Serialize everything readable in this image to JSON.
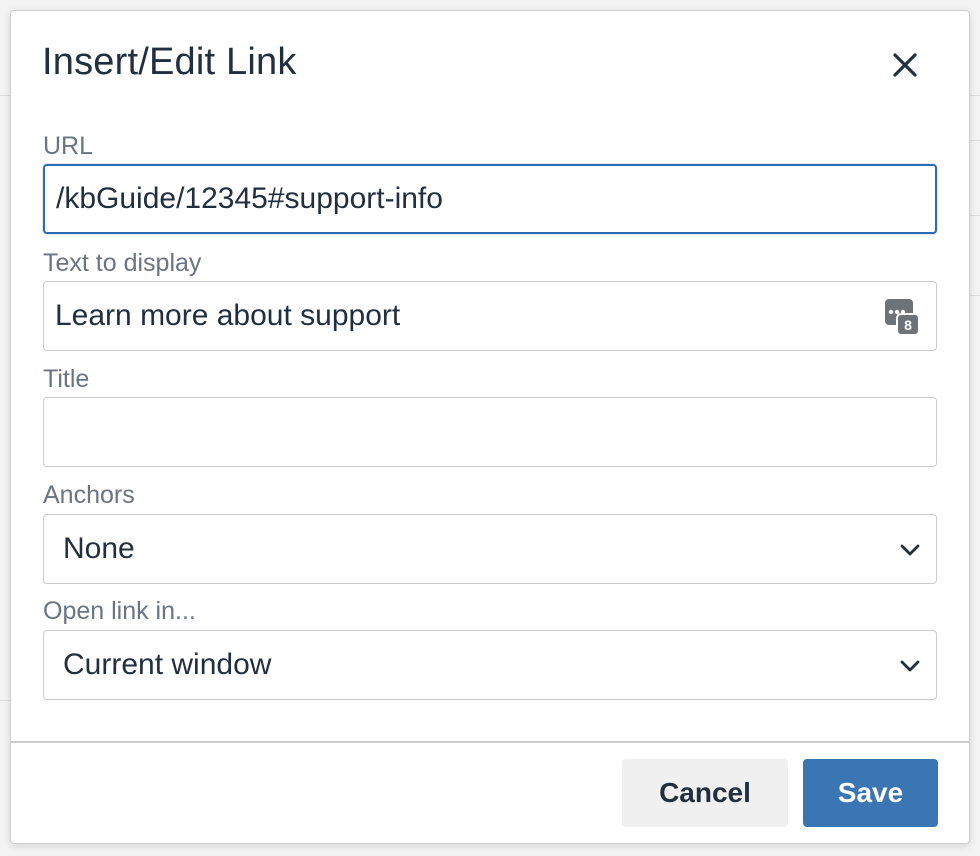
{
  "dialog": {
    "title": "Insert/Edit Link",
    "close_icon": "close-icon"
  },
  "fields": {
    "url": {
      "label": "URL",
      "value": "/kbGuide/12345#support-info"
    },
    "text_to_display": {
      "label": "Text to display",
      "value": "Learn more about support",
      "badge_icon": "password-manager-icon",
      "badge_count": "8"
    },
    "title": {
      "label": "Title",
      "value": ""
    },
    "anchors": {
      "label": "Anchors",
      "selected": "None"
    },
    "open_link_in": {
      "label": "Open link in...",
      "selected": "Current window"
    }
  },
  "buttons": {
    "cancel_label": "Cancel",
    "save_label": "Save"
  },
  "colors": {
    "accent": "#3a75b4",
    "focus_border": "#2d6bb5",
    "text": "#222f3e",
    "label": "#6b7480"
  }
}
